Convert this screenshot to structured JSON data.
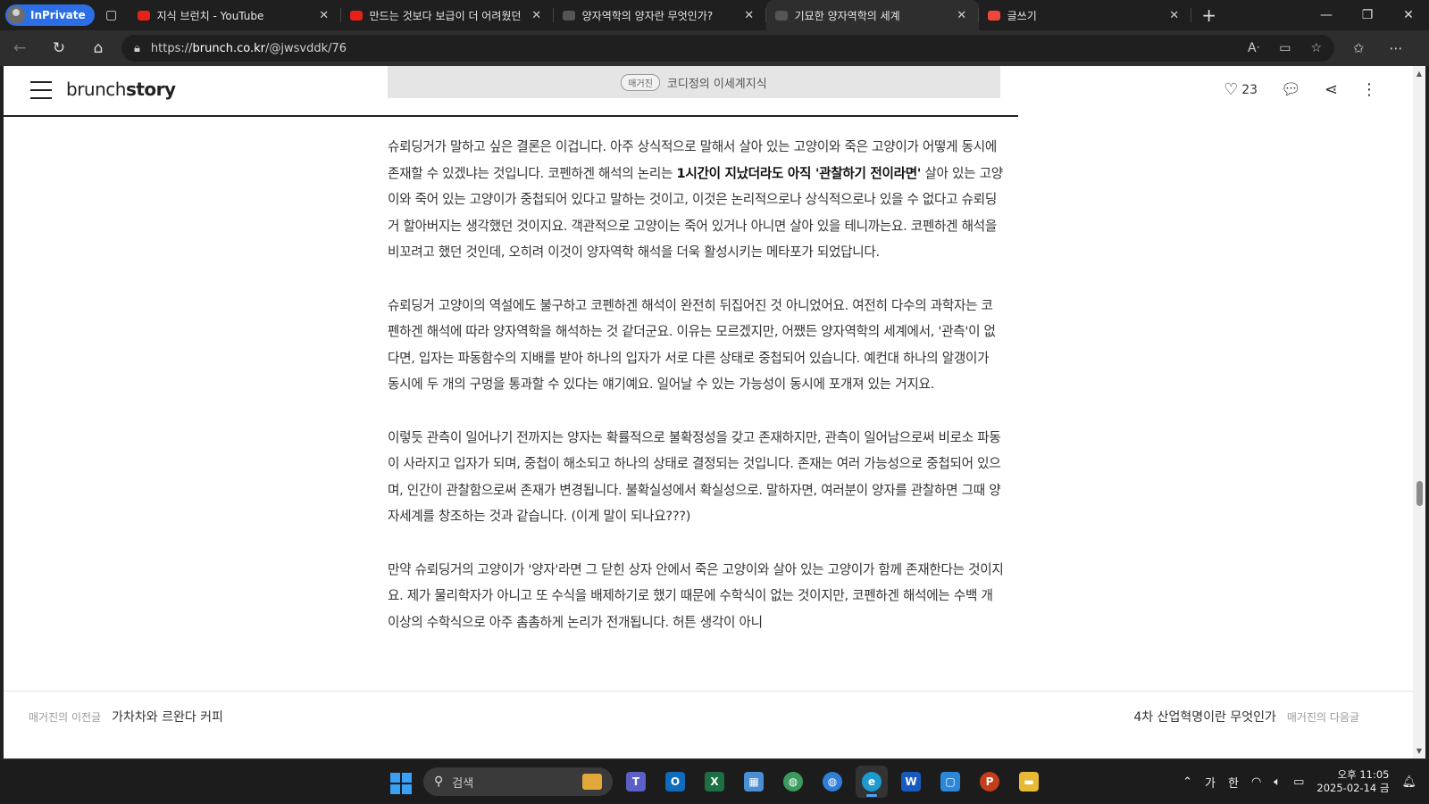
{
  "browser": {
    "inprivate_label": "InPrivate",
    "tabs": [
      {
        "title": "지식 브런치 - YouTube",
        "color": "#e62117",
        "active": false
      },
      {
        "title": "만드는 것보다 보급이 더 어려웠던",
        "color": "#e62117",
        "active": false
      },
      {
        "title": "양자역학의 양자란 무엇인가?",
        "color": "#555555",
        "active": false
      },
      {
        "title": "기묘한 양자역학의 세계",
        "color": "#555555",
        "active": true
      },
      {
        "title": "글쓰기",
        "color": "#f0463c",
        "active": false
      }
    ],
    "url_prefix": "https://",
    "url_host": "brunch.co.kr",
    "url_path": "/@jwsvddk/76"
  },
  "page": {
    "logo_a": "brunch",
    "logo_b": "story",
    "magazine_badge": "매거진",
    "magazine_name": "코디정의 이세계지식",
    "like_count": "23",
    "paragraphs": [
      {
        "pre": "슈뢰딩거가 말하고 싶은 결론은 이겁니다. 아주 상식적으로 말해서 살아 있는 고양이와 죽은 고양이가 어떻게 동시에 존재할 수 있겠냐는 것입니다. 코펜하겐 해석의 논리는 ",
        "bold": "1시간이 지났더라도 아직 '관찰하기 전이라면'",
        "post": " 살아 있는 고양이와 죽어 있는 고양이가 중첩되어 있다고 말하는 것이고, 이것은 논리적으로나 상식적으로나 있을 수 없다고 슈뢰딩거 할아버지는 생각했던 것이지요. 객관적으로 고양이는 죽어 있거나 아니면 살아 있을 테니까는요. 코펜하겐 해석을 비꼬려고 했던 것인데, 오히려 이것이 양자역학 해석을 더욱 활성시키는 메타포가 되었답니다."
      },
      {
        "pre": "슈뢰딩거 고양이의 역설에도 불구하고 코펜하겐 해석이 완전히 뒤집어진 것 아니었어요. 여전히 다수의 과학자는 코펜하겐 해석에 따라 양자역학을 해석하는 것 같더군요. 이유는 모르겠지만, 어쨌든 양자역학의 세계에서, '관측'이 없다면, 입자는 파동함수의 지배를 받아 하나의 입자가 서로 다른 상태로 중첩되어 있습니다. 예컨대 하나의 알갱이가 동시에 두 개의 구멍을 통과할 수 있다는 얘기예요. 일어날 수 있는 가능성이 동시에 포개져 있는 거지요.",
        "bold": "",
        "post": ""
      },
      {
        "pre": "이렇듯 관측이 일어나기 전까지는 양자는 확률적으로 불확정성을 갖고 존재하지만, 관측이 일어남으로써 비로소 파동이 사라지고 입자가 되며, 중첩이 해소되고 하나의 상태로 결정되는 것입니다. 존재는 여러 가능성으로 중첩되어 있으며, 인간이 관찰함으로써 존재가 변경됩니다. 불확실성에서 확실성으로. 말하자면, 여러분이 양자를 관찰하면 그때 양자세계를 창조하는 것과 같습니다. (이게 말이 되나요???)",
        "bold": "",
        "post": ""
      },
      {
        "pre": "만약 슈뢰딩거의 고양이가 '양자'라면 그 닫힌 상자 안에서 죽은 고양이와 살아 있는 고양이가 함께 존재한다는 것이지요. 제가 물리학자가 아니고 또 수식을 배제하기로 했기 때문에 수학식이 없는 것이지만, 코펜하겐 해석에는 수백 개 이상의 수학식으로 아주 촘촘하게 논리가 전개됩니다. 허튼 생각이 아니",
        "bold": "",
        "post": ""
      }
    ],
    "prev_label": "매거진의 이전글",
    "prev_title": "가차차와 르완다 커피",
    "next_label": "매거진의 다음글",
    "next_title": "4차 산업혁명이란 무엇인가"
  },
  "taskbar": {
    "search_placeholder": "검색",
    "ime_a": "가",
    "ime_b": "한",
    "time": "오후 11:05",
    "date": "2025-02-14 금"
  }
}
